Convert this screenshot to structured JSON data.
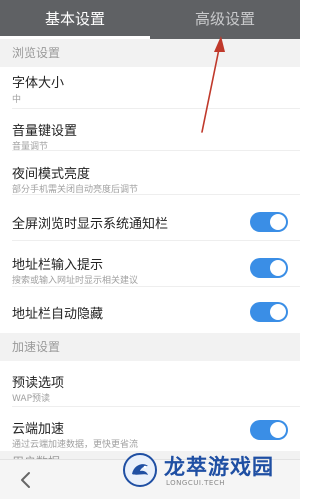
{
  "tabs": {
    "basic": "基本设置",
    "advanced": "高级设置"
  },
  "sections": {
    "browse": "浏览设置",
    "accel": "加速设置",
    "user_data_partial": "用户数据"
  },
  "items": {
    "font_size": {
      "title": "字体大小",
      "sub": "中"
    },
    "volume_key": {
      "title": "音量键设置",
      "sub": "音量调节"
    },
    "night_mode": {
      "title": "夜间模式亮度",
      "sub": "部分手机需关闭自动亮度后调节"
    },
    "fullscreen": {
      "title": "全屏浏览时显示系统通知栏",
      "on": true
    },
    "address_hint": {
      "title": "地址栏输入提示",
      "sub": "搜索或输入网址时显示相关建议",
      "on": true
    },
    "address_autohide": {
      "title": "地址栏自动隐藏",
      "on": true
    },
    "preload": {
      "title": "预读选项",
      "sub": "WAP预读"
    },
    "cloud_accel": {
      "title": "云端加速",
      "sub": "通过云端加速数据，更快更省流",
      "on": true
    }
  },
  "watermark": {
    "name": "龙萃游戏园",
    "url": "LONGCUI.TECH"
  },
  "colors": {
    "tabbar": "#5f6164",
    "toggle_on": "#3a8ee6",
    "arrow": "#c0392b",
    "watermark": "#1f4fa3"
  },
  "icons": {
    "back": "chevron-left-icon",
    "logo": "dragon-logo-icon"
  }
}
